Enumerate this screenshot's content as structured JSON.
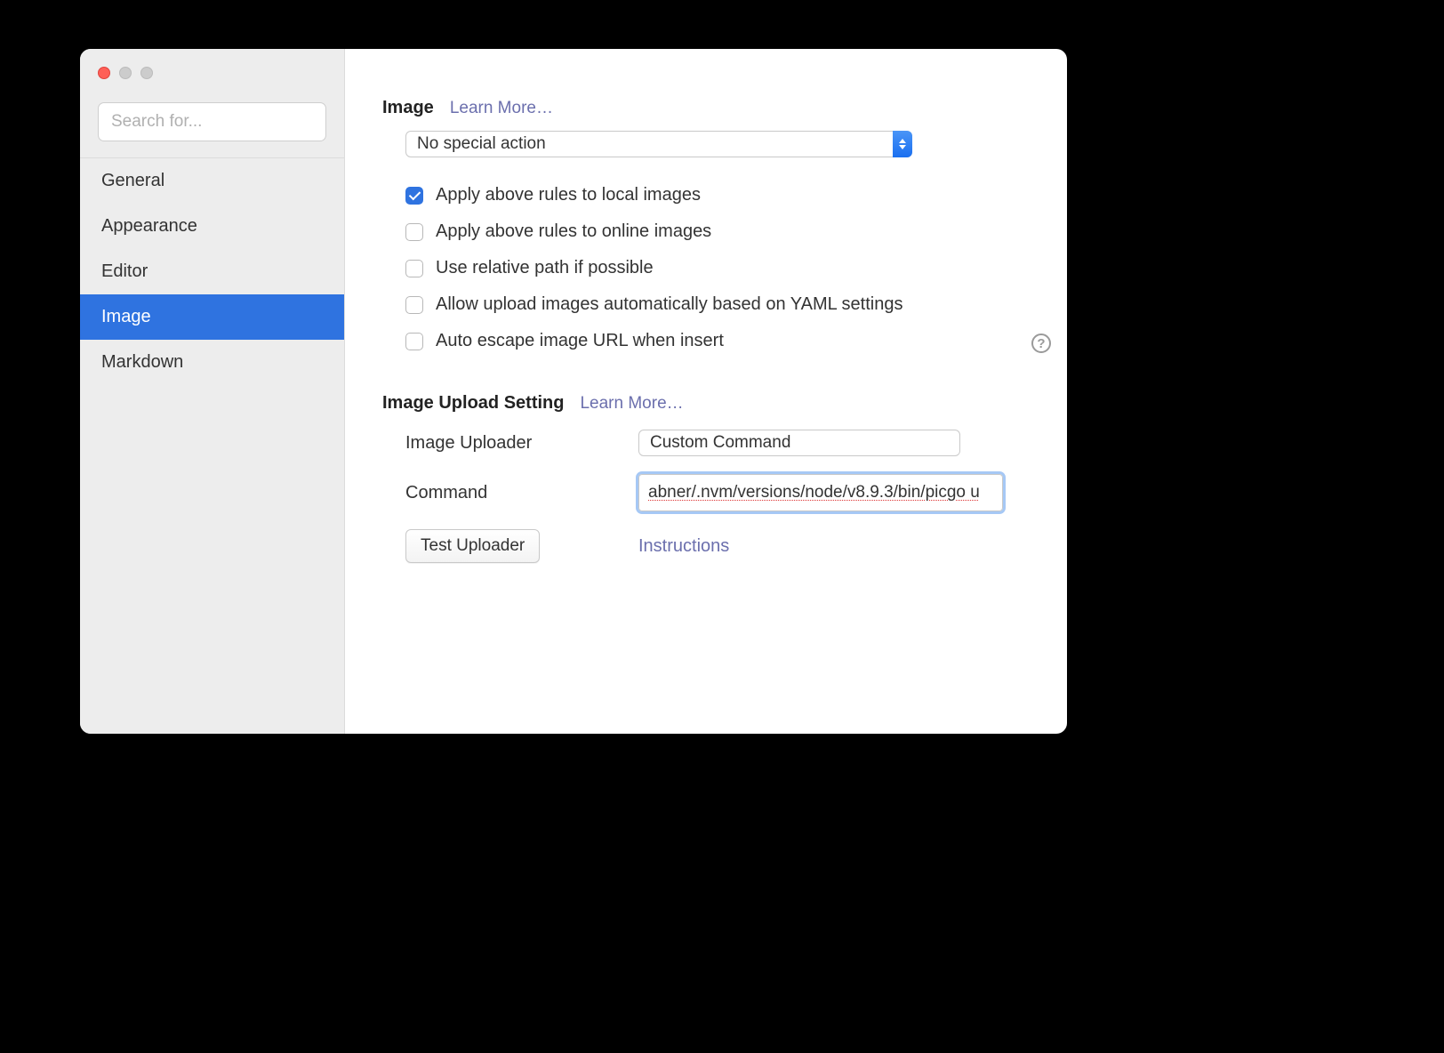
{
  "sidebar": {
    "search_placeholder": "Search for...",
    "items": [
      {
        "label": "General"
      },
      {
        "label": "Appearance"
      },
      {
        "label": "Editor"
      },
      {
        "label": "Image"
      },
      {
        "label": "Markdown"
      }
    ],
    "selected_index": 3
  },
  "image_section": {
    "title": "Image",
    "learn_more": "Learn More…",
    "action_select": "No special action",
    "checkboxes": [
      {
        "label": "Apply above rules to local images",
        "checked": true
      },
      {
        "label": "Apply above rules to online images",
        "checked": false
      },
      {
        "label": "Use relative path if possible",
        "checked": false
      },
      {
        "label": "Allow upload images automatically based on YAML settings",
        "checked": false
      },
      {
        "label": "Auto escape image URL when insert",
        "checked": false
      }
    ]
  },
  "upload_section": {
    "title": "Image Upload Setting",
    "learn_more": "Learn More…",
    "uploader_label": "Image Uploader",
    "uploader_value": "Custom Command",
    "command_label": "Command",
    "command_value": "abner/.nvm/versions/node/v8.9.3/bin/picgo u",
    "test_button": "Test Uploader",
    "instructions": "Instructions"
  }
}
